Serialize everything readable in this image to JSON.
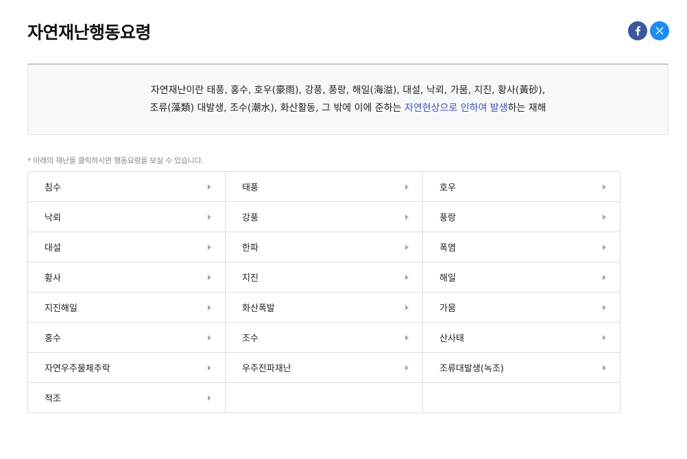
{
  "page": {
    "title": "자연재난행동요령"
  },
  "share": {
    "facebook_icon": "facebook-icon",
    "x_icon": "x-icon",
    "colors": {
      "facebook": "#3b5998",
      "x": "#1d8cf0"
    }
  },
  "definition": {
    "line1": "자연재난이란 태풍, 홍수, 호우(豪雨), 강풍, 풍랑, 해일(海溢), 대설, 낙뢰, 가뭄, 지진, 황사(黃砂),",
    "line2_prefix": "조류(藻類) 대발생, 조수(潮水), 화산활동, 그 밖에 이에 준하는 ",
    "line2_highlight": "자연현상으로 인하여 발생",
    "line2_suffix": "하는 재해",
    "highlight_color": "#3a55b4"
  },
  "hint": "* 아래의 재난을 클릭하시면 행동요령을 보실 수 있습니다.",
  "disasters": [
    "침수",
    "태풍",
    "호우",
    "낙뢰",
    "강풍",
    "풍랑",
    "대설",
    "한파",
    "폭염",
    "황사",
    "지진",
    "해일",
    "지진해일",
    "화산폭발",
    "가뭄",
    "홍수",
    "조수",
    "산사태",
    "자연우주물체추락",
    "우주전파재난",
    "조류대발생(녹조)",
    "적조"
  ],
  "arrow_icon": "chevron-right-icon"
}
